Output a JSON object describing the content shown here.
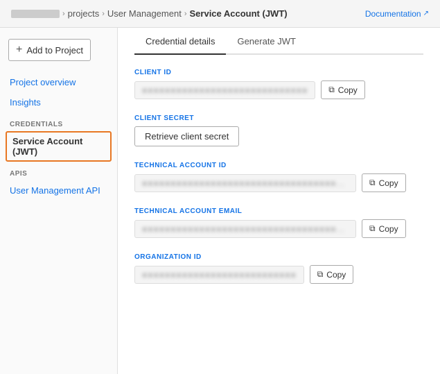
{
  "header": {
    "brand_placeholder": "brand",
    "breadcrumbs": [
      {
        "label": "projects",
        "link": true
      },
      {
        "label": "User Management",
        "link": true
      },
      {
        "label": "Service Account (JWT)",
        "link": false,
        "bold": true
      }
    ],
    "doc_link_label": "Documentation",
    "doc_link_icon": "↗"
  },
  "sidebar": {
    "add_btn_label": "Add to Project",
    "add_icon": "+",
    "items": [
      {
        "label": "Project overview",
        "type": "link",
        "section": null
      },
      {
        "label": "Insights",
        "type": "link",
        "section": null
      },
      {
        "label": "CREDENTIALS",
        "type": "section"
      },
      {
        "label": "Service Account (JWT)",
        "type": "active",
        "section": "credentials"
      },
      {
        "label": "APIS",
        "type": "section"
      },
      {
        "label": "User Management API",
        "type": "link",
        "section": "apis"
      }
    ]
  },
  "content": {
    "tabs": [
      {
        "label": "Credential details",
        "active": true
      },
      {
        "label": "Generate JWT",
        "active": false
      }
    ],
    "sections": [
      {
        "id": "client-id",
        "label": "CLIENT ID",
        "type": "value-copy",
        "value": "●●●●●●●●●●●●●●●●●●●●●●●●●●●●●",
        "copy_label": "Copy"
      },
      {
        "id": "client-secret",
        "label": "CLIENT SECRET",
        "type": "retrieve",
        "retrieve_label": "Retrieve client secret"
      },
      {
        "id": "technical-account-id",
        "label": "TECHNICAL ACCOUNT ID",
        "type": "value-copy",
        "value": "●●●●●●●●●●●●●●●●●●●●●●●●●●●●●●●●●●●●●",
        "copy_label": "Copy"
      },
      {
        "id": "technical-account-email",
        "label": "TECHNICAL ACCOUNT EMAIL",
        "type": "value-copy",
        "value": "●●●●●●●●●●●●●●●●●●●●●●●●●●●●●●●●●●●●●●●●●",
        "copy_label": "Copy"
      },
      {
        "id": "organization-id",
        "label": "ORGANIZATION ID",
        "type": "value-copy",
        "value": "●●●●●●●●●●●●●●●●●●●●●●●●●●●",
        "copy_label": "Copy"
      }
    ]
  }
}
